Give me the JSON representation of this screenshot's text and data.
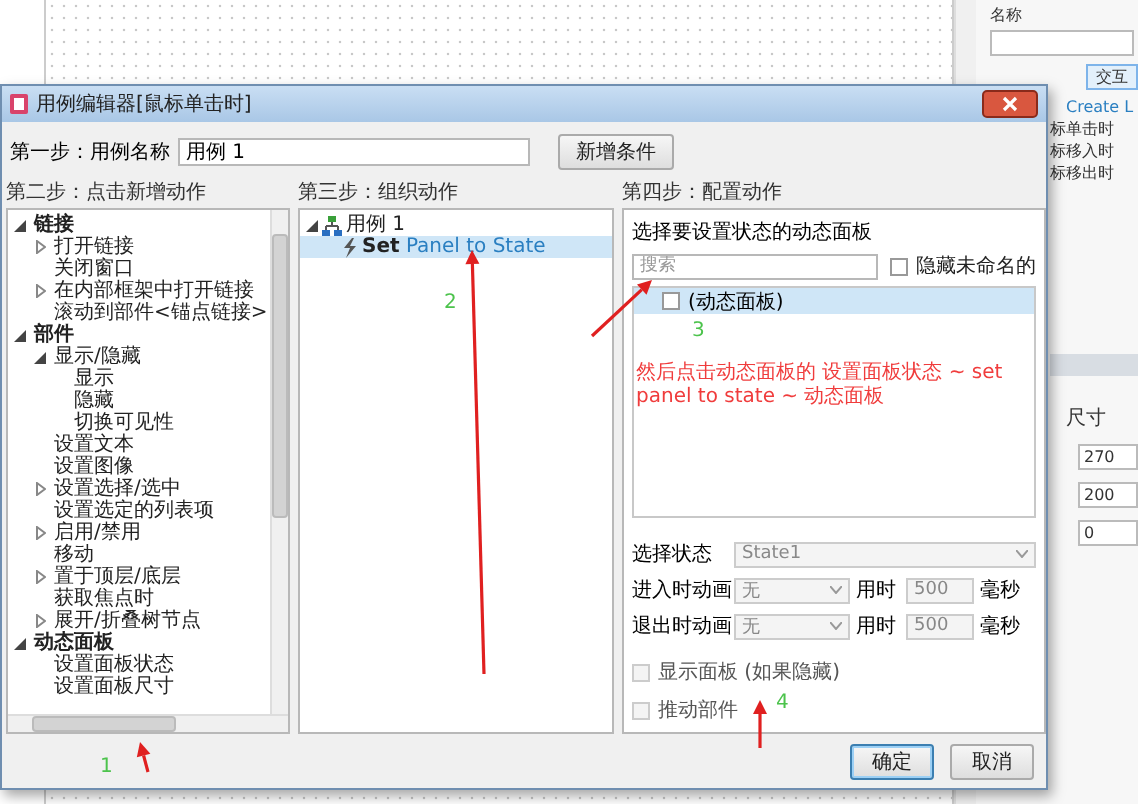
{
  "background": {
    "properties": {
      "name_label": "名称",
      "interaction_button": "交互",
      "create_link": "Create L",
      "events": [
        "标单击时",
        "标移入时",
        "标移出时"
      ],
      "size_label": "尺寸",
      "size_values": [
        "270",
        "200",
        "0"
      ]
    }
  },
  "dialog": {
    "title": "用例编辑器[鼠标单击时]",
    "step1": {
      "label": "第一步：用例名称",
      "value": "用例 1",
      "button": "新增条件"
    },
    "step2": {
      "heading": "第二步：点击新增动作",
      "tree": [
        {
          "label": "链接",
          "expanded": true,
          "children": [
            {
              "label": "打开链接",
              "expanded": false
            },
            {
              "label": "关闭窗口"
            },
            {
              "label": "在内部框架中打开链接",
              "expanded": false
            },
            {
              "label": "滚动到部件<锚点链接>"
            }
          ]
        },
        {
          "label": "部件",
          "expanded": true,
          "children": [
            {
              "label": "显示/隐藏",
              "expanded": true,
              "children": [
                {
                  "label": "显示"
                },
                {
                  "label": "隐藏"
                },
                {
                  "label": "切换可见性"
                }
              ]
            },
            {
              "label": "设置文本"
            },
            {
              "label": "设置图像"
            },
            {
              "label": "设置选择/选中",
              "expanded": false
            },
            {
              "label": "设置选定的列表项"
            },
            {
              "label": "启用/禁用",
              "expanded": false
            },
            {
              "label": "移动"
            },
            {
              "label": "置于顶层/底层",
              "expanded": false
            },
            {
              "label": "获取焦点时"
            },
            {
              "label": "展开/折叠树节点",
              "expanded": false
            }
          ]
        },
        {
          "label": "动态面板",
          "expanded": true,
          "children": [
            {
              "label": "设置面板状态"
            },
            {
              "label": "设置面板尺寸"
            }
          ]
        }
      ]
    },
    "step3": {
      "heading": "第三步：组织动作",
      "tree": [
        {
          "label": "用例 1",
          "kind": "case",
          "expanded": true,
          "selected": false,
          "children": [
            {
              "label": "**Set** Panel to State",
              "kind": "action",
              "selected": true
            }
          ]
        }
      ]
    },
    "step4": {
      "heading": "第四步：配置动作",
      "panel_label": "选择要设置状态的动态面板",
      "search": {
        "placeholder": "搜索"
      },
      "hide_unnamed": {
        "label": "隐藏未命名的",
        "checked": false
      },
      "panels": [
        {
          "label": "(动态面板)",
          "checked": false,
          "selected": true
        }
      ],
      "state": {
        "label": "选择状态",
        "value": "State1",
        "disabled": true
      },
      "animations": [
        {
          "label": "进入时动画",
          "value": "无",
          "time_label": "用时",
          "time": "500",
          "unit": "毫秒",
          "disabled": true
        },
        {
          "label": "退出时动画",
          "value": "无",
          "time_label": "用时",
          "time": "500",
          "unit": "毫秒",
          "disabled": true
        }
      ],
      "options": [
        {
          "label": "显示面板 (如果隐藏)",
          "checked": false,
          "disabled": true
        },
        {
          "label": "推动部件",
          "checked": false,
          "disabled": true
        }
      ]
    },
    "buttons": [
      {
        "label": "确定",
        "default": true
      },
      {
        "label": "取消",
        "default": false
      }
    ]
  },
  "annotations": {
    "note": "然后点击动态面板的 设置面板状态 ~ set panel to state ~ 动态面板",
    "step_numbers": [
      "1",
      "2",
      "3",
      "4"
    ]
  }
}
